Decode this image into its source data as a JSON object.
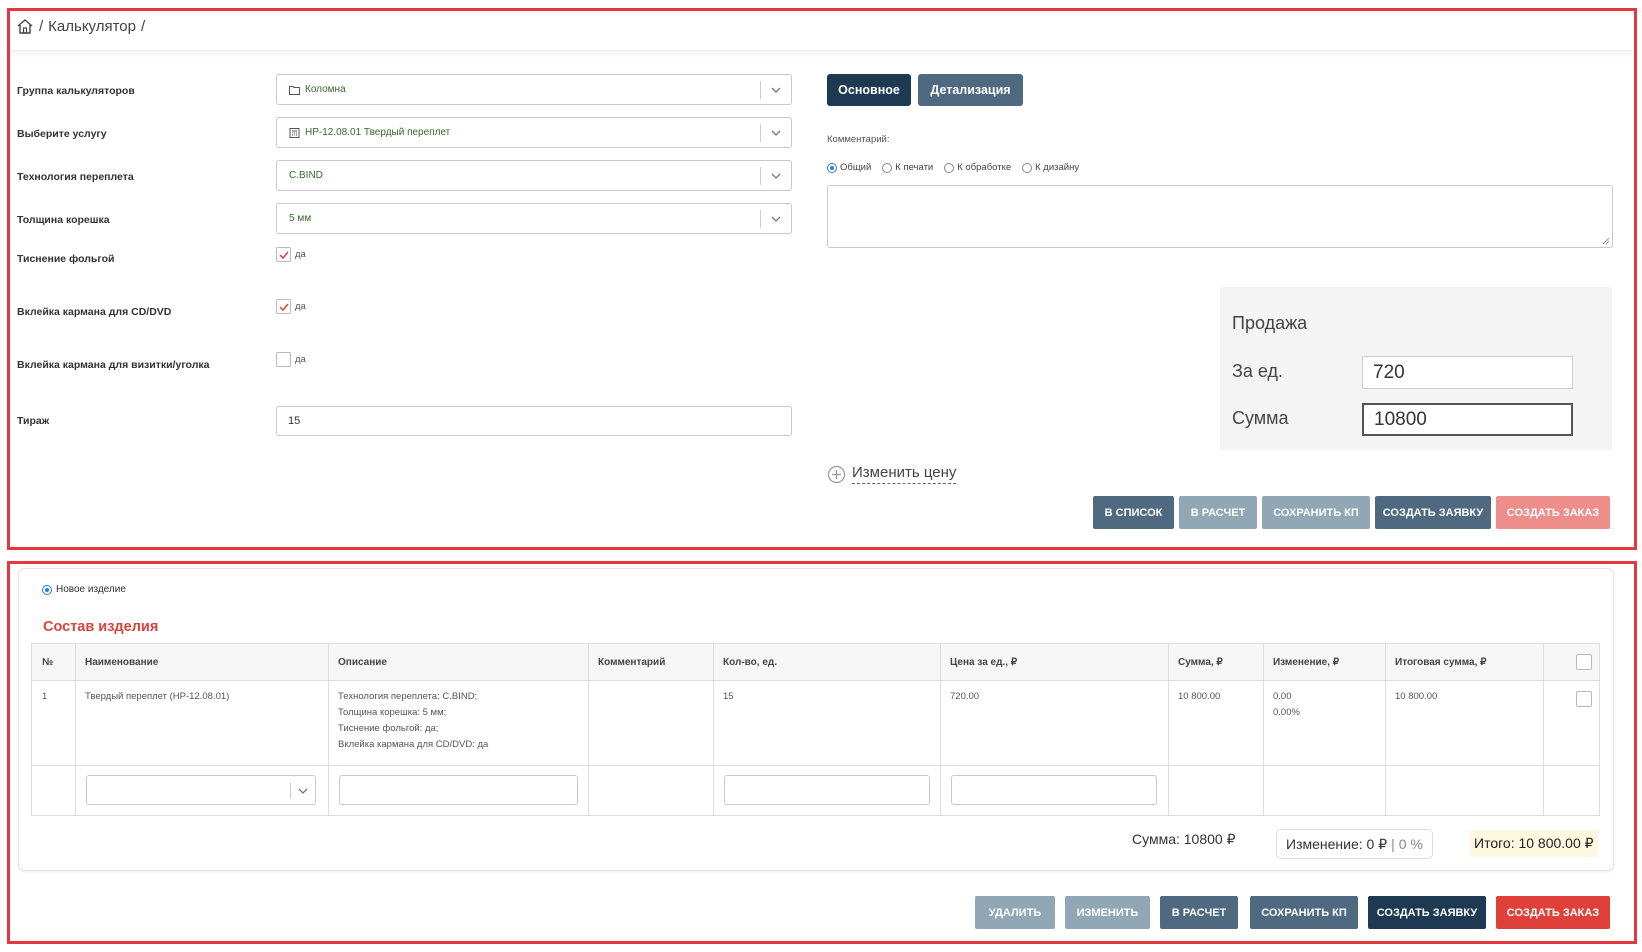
{
  "breadcrumb": {
    "home": "⌂",
    "sep1": "/",
    "current": "Калькулятор",
    "sep2": "/"
  },
  "form": {
    "group_label": "Группа калькуляторов",
    "group_value": "Коломна",
    "service_label": "Выберите услугу",
    "service_value": "НР-12.08.01 Твердый переплет",
    "tech_label": "Технология переплета",
    "tech_value": "C.BIND",
    "spine_label": "Толщина корешка",
    "spine_value": "5 мм",
    "foil_label": "Тиснение фольгой",
    "foil_option": "да",
    "foil_checked": true,
    "cd_label": "Вклейка кармана для CD/DVD",
    "cd_option": "да",
    "cd_checked": true,
    "card_label": "Вклейка кармана для визитки/уголка",
    "card_option": "да",
    "card_checked": false,
    "run_label": "Тираж",
    "run_value": "15"
  },
  "tabs": {
    "main": "Основное",
    "detail": "Детализация"
  },
  "comment": {
    "label": "Комментарий:",
    "options": [
      "Общий",
      "К печати",
      "К обработке",
      "К дизайну"
    ],
    "selected": "Общий"
  },
  "sale": {
    "title": "Продажа",
    "unit_label": "За ед.",
    "unit_value": "720",
    "sum_label": "Сумма",
    "sum_value": "10800"
  },
  "change_price": "Изменить цену",
  "top_buttons": {
    "to_list": "В СПИСОК",
    "to_calc": "В РАСЧЕТ",
    "save_kp": "СОХРАНИТЬ КП",
    "create_request": "СОЗДАТЬ ЗАЯВКУ",
    "create_order": "СОЗДАТЬ ЗАКАЗ"
  },
  "product": {
    "new_item": "Новое изделие",
    "section_title": "Состав изделия",
    "columns": [
      "№",
      "Наименование",
      "Описание",
      "Комментарий",
      "Кол-во, ед.",
      "Цена за ед., ₽",
      "Сумма, ₽",
      "Изменение, ₽",
      "Итоговая сумма, ₽"
    ],
    "rows": [
      {
        "num": "1",
        "name": "Твердый переплет (НР-12.08.01)",
        "desc1": "Технология переплета: C.BIND;",
        "desc2": "Толщина корешка: 5 мм;",
        "desc3": "Тиснение фольгой: да;",
        "desc4": "Вклейка кармана для CD/DVD: да",
        "comment": "",
        "qty": "15",
        "price": "720.00",
        "sum": "10 800.00",
        "change": "0.00",
        "change_pct": "0.00%",
        "total": "10 800.00"
      }
    ]
  },
  "totals": {
    "sum": "Сумма: 10800 ₽",
    "change": "Изменение: 0 ₽",
    "change_sep": "|",
    "change_pct": "0 %",
    "total": "Итого: 10 800.00 ₽"
  },
  "bottom_buttons": {
    "delete": "УДАЛИТЬ",
    "edit": "ИЗМЕНИТЬ",
    "to_calc": "В РАСЧЕТ",
    "save_kp": "СОХРАНИТЬ КП",
    "create_request": "СОЗДАТЬ ЗАЯВКУ",
    "create_order": "СОЗДАТЬ ЗАКАЗ"
  },
  "colors": {
    "frame_red": "#e5373d",
    "dark_navy": "#1d3a52",
    "slate": "#4f6a80",
    "slate_light": "#91a7b6",
    "red_btn": "#e0403a",
    "red_light": "#ee8e8a",
    "title_red": "#d9433b"
  }
}
